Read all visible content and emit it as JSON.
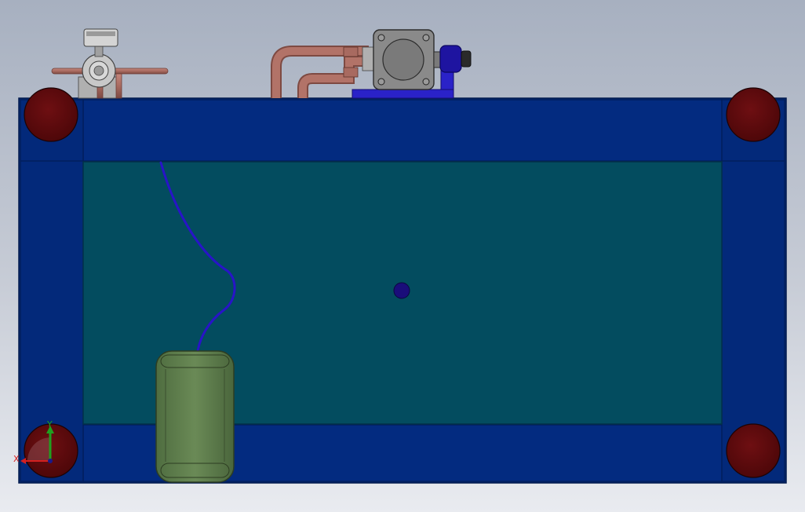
{
  "viewport": {
    "background_top": "#a7b0c0",
    "background_bottom": "#e9ebf0"
  },
  "frame": {
    "color": "#03297a",
    "edge_color": "#021d57",
    "panel_color": "#034c5f"
  },
  "corner_caps": {
    "color": "#5f0a0d",
    "count": 4
  },
  "center_marker": {
    "color": "#1a0d7a"
  },
  "hose": {
    "color": "#2814c8"
  },
  "tank": {
    "fill": "#5a7a4a",
    "highlight": "#7e9a66"
  },
  "piping": {
    "color": "#a86a60"
  },
  "pump_body": {
    "color": "#8a8a8a"
  },
  "motor": {
    "color": "#1e14a0"
  },
  "mount_plate": {
    "color": "#2a22c8"
  },
  "coordinate_triad": {
    "x_label": "X",
    "y_label": "Y",
    "x_color": "#d42020",
    "y_color": "#20a020"
  }
}
